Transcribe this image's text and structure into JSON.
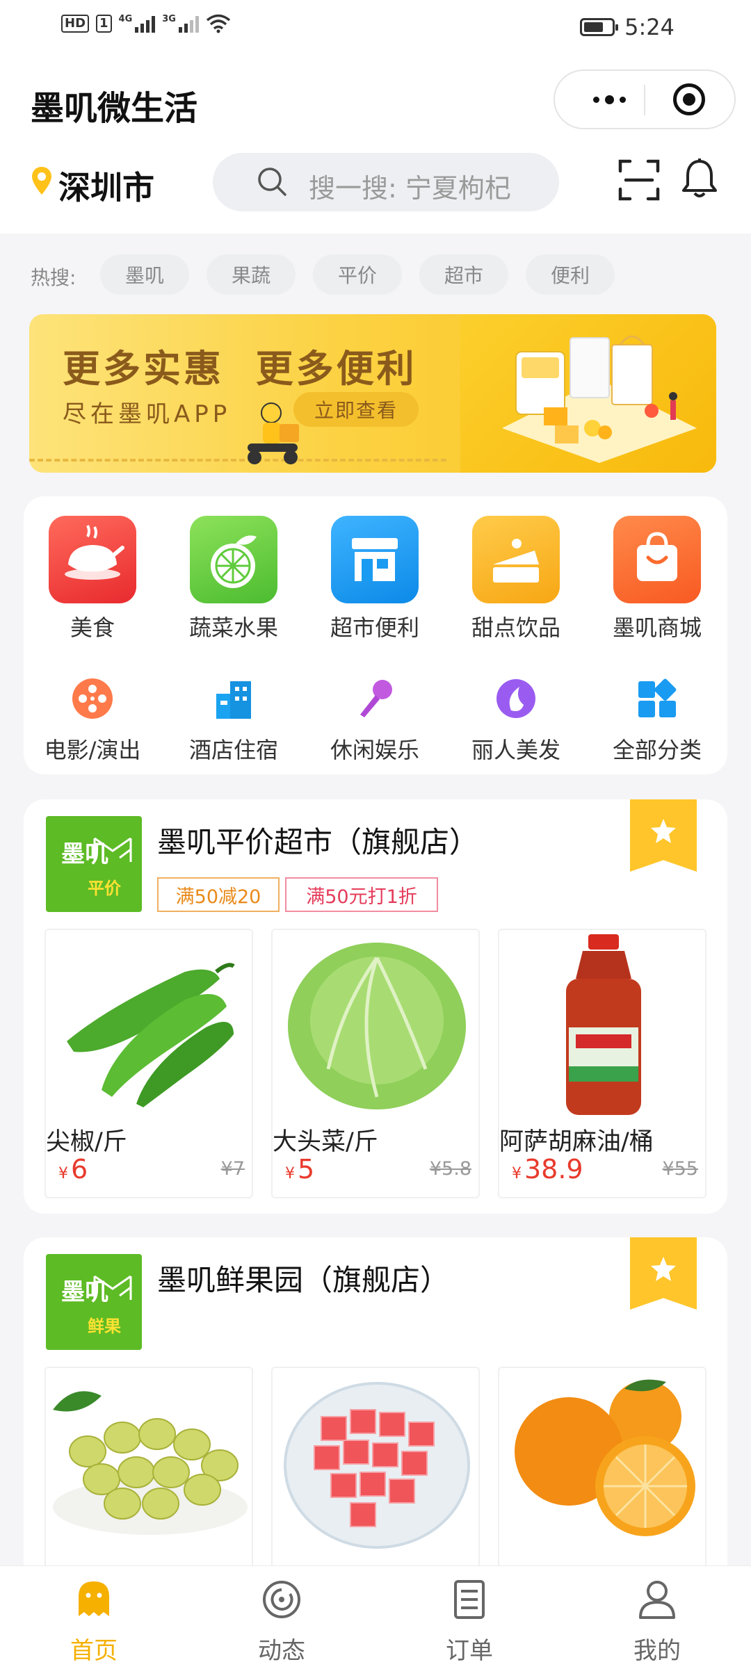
{
  "status_bar": {
    "hd": "HD",
    "sim": "1",
    "net1": "4G",
    "net2": "3G",
    "time": "5:24"
  },
  "header": {
    "title": "墨叽微生活",
    "city": "深圳市",
    "search_placeholder": "搜一搜: 宁夏枸杞"
  },
  "hot_search": {
    "label": "热搜:",
    "chips": [
      "墨叽",
      "果蔬",
      "平价",
      "超市",
      "便利"
    ]
  },
  "banner": {
    "headline": "更多实惠  更多便利",
    "subline": "尽在墨叽APP",
    "button": "立即查看"
  },
  "categories_primary": [
    {
      "label": "美食",
      "icon": "roast-chicken-icon",
      "color": "#f0393c"
    },
    {
      "label": "蔬菜水果",
      "icon": "orange-fruit-icon",
      "color": "#5fcb3b"
    },
    {
      "label": "超市便利",
      "icon": "store-icon",
      "color": "#1a9bf2"
    },
    {
      "label": "甜点饮品",
      "icon": "cake-icon",
      "color": "#f9b21d"
    },
    {
      "label": "墨叽商城",
      "icon": "shopping-bag-icon",
      "color": "#fb6a2c"
    }
  ],
  "categories_secondary": [
    {
      "label": "电影/演出",
      "icon": "film-reel-icon"
    },
    {
      "label": "酒店住宿",
      "icon": "hotel-building-icon"
    },
    {
      "label": "休闲娱乐",
      "icon": "microphone-icon"
    },
    {
      "label": "丽人美发",
      "icon": "beauty-icon"
    },
    {
      "label": "全部分类",
      "icon": "grid-categories-icon"
    }
  ],
  "shops": [
    {
      "name": "墨叽平价超市（旗舰店）",
      "logo_top": "墨叽",
      "logo_tag": "平价",
      "promos": [
        "满50减20",
        "满50元打1折"
      ],
      "products": [
        {
          "name": "尖椒/斤",
          "currency": "¥",
          "price": "6",
          "original": "¥7"
        },
        {
          "name": "大头菜/斤",
          "currency": "¥",
          "price": "5",
          "original": "¥5.8"
        },
        {
          "name": "阿萨胡麻油/桶",
          "currency": "¥",
          "price": "38.9",
          "original": "¥55"
        }
      ]
    },
    {
      "name": "墨叽鲜果园（旗舰店）",
      "logo_top": "墨叽",
      "logo_tag": "鲜果",
      "products": [
        {
          "image": "green-olives"
        },
        {
          "image": "watermelon-cubes"
        },
        {
          "image": "oranges"
        }
      ]
    }
  ],
  "tabbar": [
    {
      "label": "首页",
      "icon": "home-mascot-icon",
      "active": true
    },
    {
      "label": "动态",
      "icon": "activity-icon",
      "active": false
    },
    {
      "label": "订单",
      "icon": "orders-icon",
      "active": false
    },
    {
      "label": "我的",
      "icon": "profile-icon",
      "active": false
    }
  ],
  "colors": {
    "accent": "#f5b000",
    "price_red": "#e83a2c",
    "brand_green": "#5dbb25"
  }
}
